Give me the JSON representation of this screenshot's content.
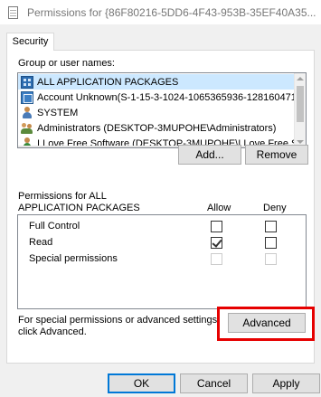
{
  "window": {
    "title": "Permissions for {86F80216-5DD6-4F43-953B-35EF40A35..."
  },
  "tabs": [
    {
      "label": "Security"
    }
  ],
  "group_section": {
    "label": "Group or user names:",
    "items": [
      {
        "icon": "package-icon",
        "label": "ALL APPLICATION PACKAGES"
      },
      {
        "icon": "unknown-account-icon",
        "label": "Account Unknown(S-1-15-3-1024-1065365936-128160471"
      },
      {
        "icon": "user-icon",
        "label": "SYSTEM"
      },
      {
        "icon": "users-group-icon",
        "label": "Administrators (DESKTOP-3MUPOHE\\Administrators)"
      },
      {
        "icon": "person-icon",
        "label": "I Love Free Software (DESKTOP-3MUPOHE\\I Love Free S"
      }
    ],
    "add_button": "Add...",
    "remove_button": "Remove"
  },
  "permissions_section": {
    "label_line1": "Permissions for ALL",
    "label_line2": "APPLICATION PACKAGES",
    "allow_header": "Allow",
    "deny_header": "Deny",
    "rows": [
      {
        "name": "Full Control",
        "allow": false,
        "deny": false,
        "enabled": true
      },
      {
        "name": "Read",
        "allow": true,
        "deny": false,
        "enabled": true
      },
      {
        "name": "Special permissions",
        "allow": false,
        "deny": false,
        "enabled": false
      }
    ]
  },
  "advanced_section": {
    "text_line1": "For special permissions or advanced settings,",
    "text_line2": "click Advanced.",
    "button": "Advanced"
  },
  "footer": {
    "ok": "OK",
    "cancel": "Cancel",
    "apply": "Apply"
  },
  "colors": {
    "highlight_border": "#e60000",
    "primary_button_border": "#0078d7"
  }
}
